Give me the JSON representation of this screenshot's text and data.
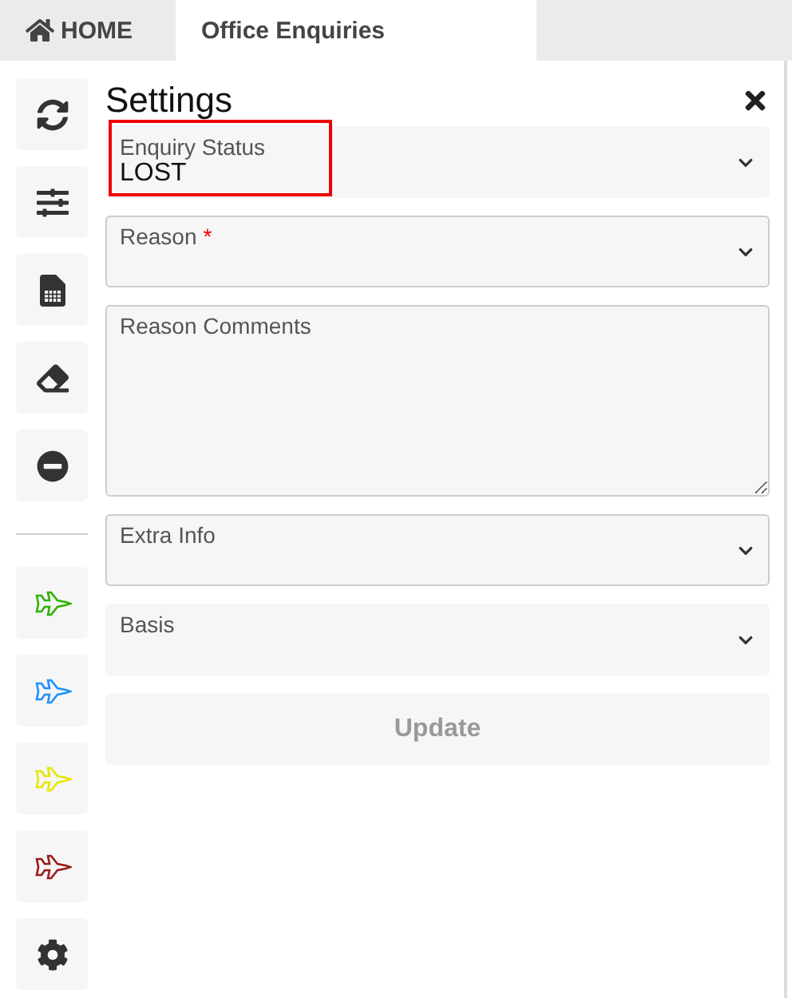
{
  "tabs": [
    {
      "label": "HOME",
      "kind": "home",
      "selected": false
    },
    {
      "label": "Office Enquiries",
      "kind": "plain",
      "selected": true
    }
  ],
  "sidebar": {
    "items": [
      {
        "kind": "refresh"
      },
      {
        "kind": "sliders"
      },
      {
        "kind": "calculator"
      },
      {
        "kind": "eraser"
      },
      {
        "kind": "block"
      },
      {
        "kind": "divider"
      },
      {
        "kind": "jet",
        "color": "#2db200"
      },
      {
        "kind": "jet",
        "color": "#1e90ff"
      },
      {
        "kind": "jet",
        "color": "#e6e600"
      },
      {
        "kind": "jet",
        "color": "#9b1b1b"
      },
      {
        "kind": "settings"
      }
    ]
  },
  "panel": {
    "title": "Settings",
    "fields": [
      {
        "kind": "select",
        "label": "Enquiry Status",
        "value": "LOST",
        "outlined": false,
        "highlighted": true
      },
      {
        "kind": "select",
        "label": "Reason",
        "required_mark": "*",
        "outlined": true,
        "highlighted": false
      },
      {
        "kind": "textarea",
        "placeholder": "Reason Comments",
        "outlined": true,
        "highlighted": false
      },
      {
        "kind": "select",
        "label": "Extra Info",
        "outlined": true,
        "highlighted": false
      },
      {
        "kind": "select",
        "label": "Basis",
        "outlined": false,
        "highlighted": false
      }
    ],
    "button": {
      "label": "Update",
      "disabled": true
    }
  }
}
